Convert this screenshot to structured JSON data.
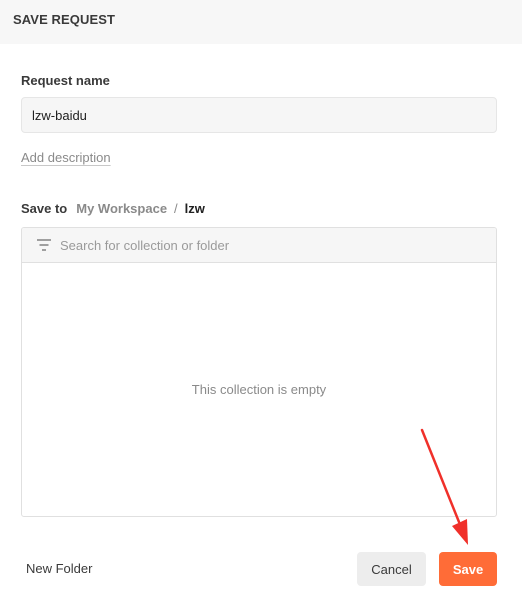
{
  "dialog": {
    "title": "SAVE REQUEST"
  },
  "request_name": {
    "label": "Request name",
    "value": "lzw-baidu"
  },
  "add_description_label": "Add description",
  "save_to": {
    "label": "Save to",
    "breadcrumb": {
      "workspace": "My Workspace",
      "separator": "/",
      "current": "lzw"
    }
  },
  "collection_browser": {
    "search_placeholder": "Search for collection or folder",
    "search_value": "",
    "empty_message": "This collection is empty"
  },
  "footer": {
    "new_folder_label": "New Folder",
    "cancel_label": "Cancel",
    "save_label": "Save"
  },
  "icons": {
    "filter": "filter-icon",
    "annotation": "red-arrow-annotation"
  },
  "colors": {
    "accent": "#ff6c37",
    "annotation": "#f0302a"
  }
}
